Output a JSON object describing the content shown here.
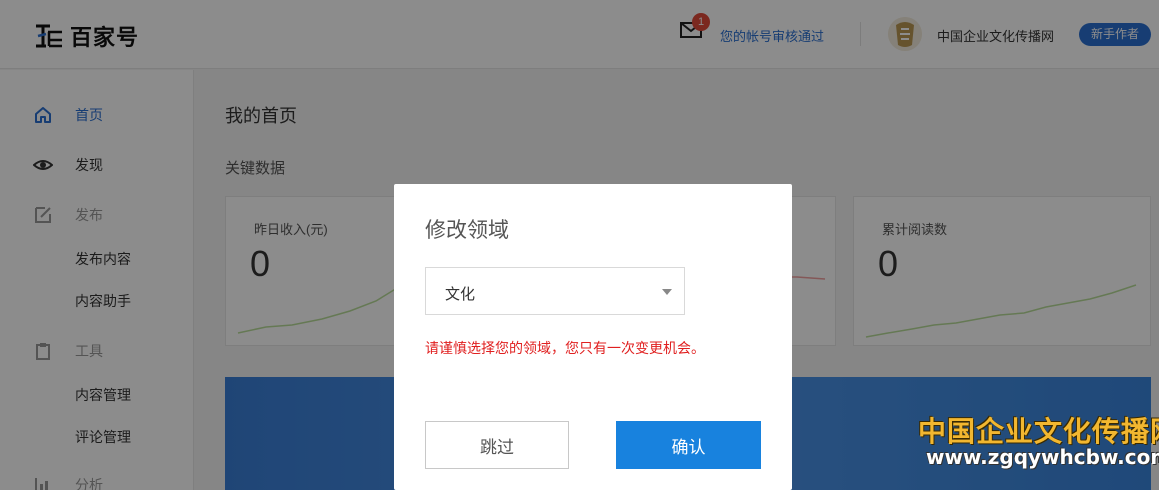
{
  "header": {
    "logo_text": "百家号",
    "mail_badge_count": "1",
    "notice_text": "您的帐号审核通过",
    "account_name": "中国企业文化传播网",
    "account_badge": "新手作者"
  },
  "sidebar": {
    "items": [
      {
        "label": "首页",
        "icon": "home-icon",
        "active": true
      },
      {
        "label": "发现",
        "icon": "eye-icon"
      },
      {
        "label": "发布",
        "icon": "edit-icon",
        "group": true
      },
      {
        "label": "发布内容"
      },
      {
        "label": "内容助手"
      },
      {
        "label": "工具",
        "icon": "clipboard-icon",
        "group": true
      },
      {
        "label": "内容管理"
      },
      {
        "label": "评论管理"
      },
      {
        "label": "分析",
        "icon": "chart-icon",
        "group": true
      }
    ]
  },
  "main": {
    "page_title": "我的首页",
    "section_title": "关键数据",
    "cards": [
      {
        "label": "昨日收入(元)",
        "value": "0"
      },
      {
        "label": "",
        "value": ""
      },
      {
        "label": "累计阅读数",
        "value": "0"
      }
    ]
  },
  "modal": {
    "title": "修改领域",
    "select_value": "文化",
    "warning": "请谨慎选择您的领域，您只有一次变更机会。",
    "skip_label": "跳过",
    "confirm_label": "确认"
  },
  "watermark": {
    "line1": "中国企业文化传播网",
    "line2": "www.zgqywhcbw.com"
  },
  "colors": {
    "accent": "#2a6fd1",
    "confirm_button": "#1882de",
    "warning": "#e02020",
    "badge_red": "#e0493a"
  }
}
